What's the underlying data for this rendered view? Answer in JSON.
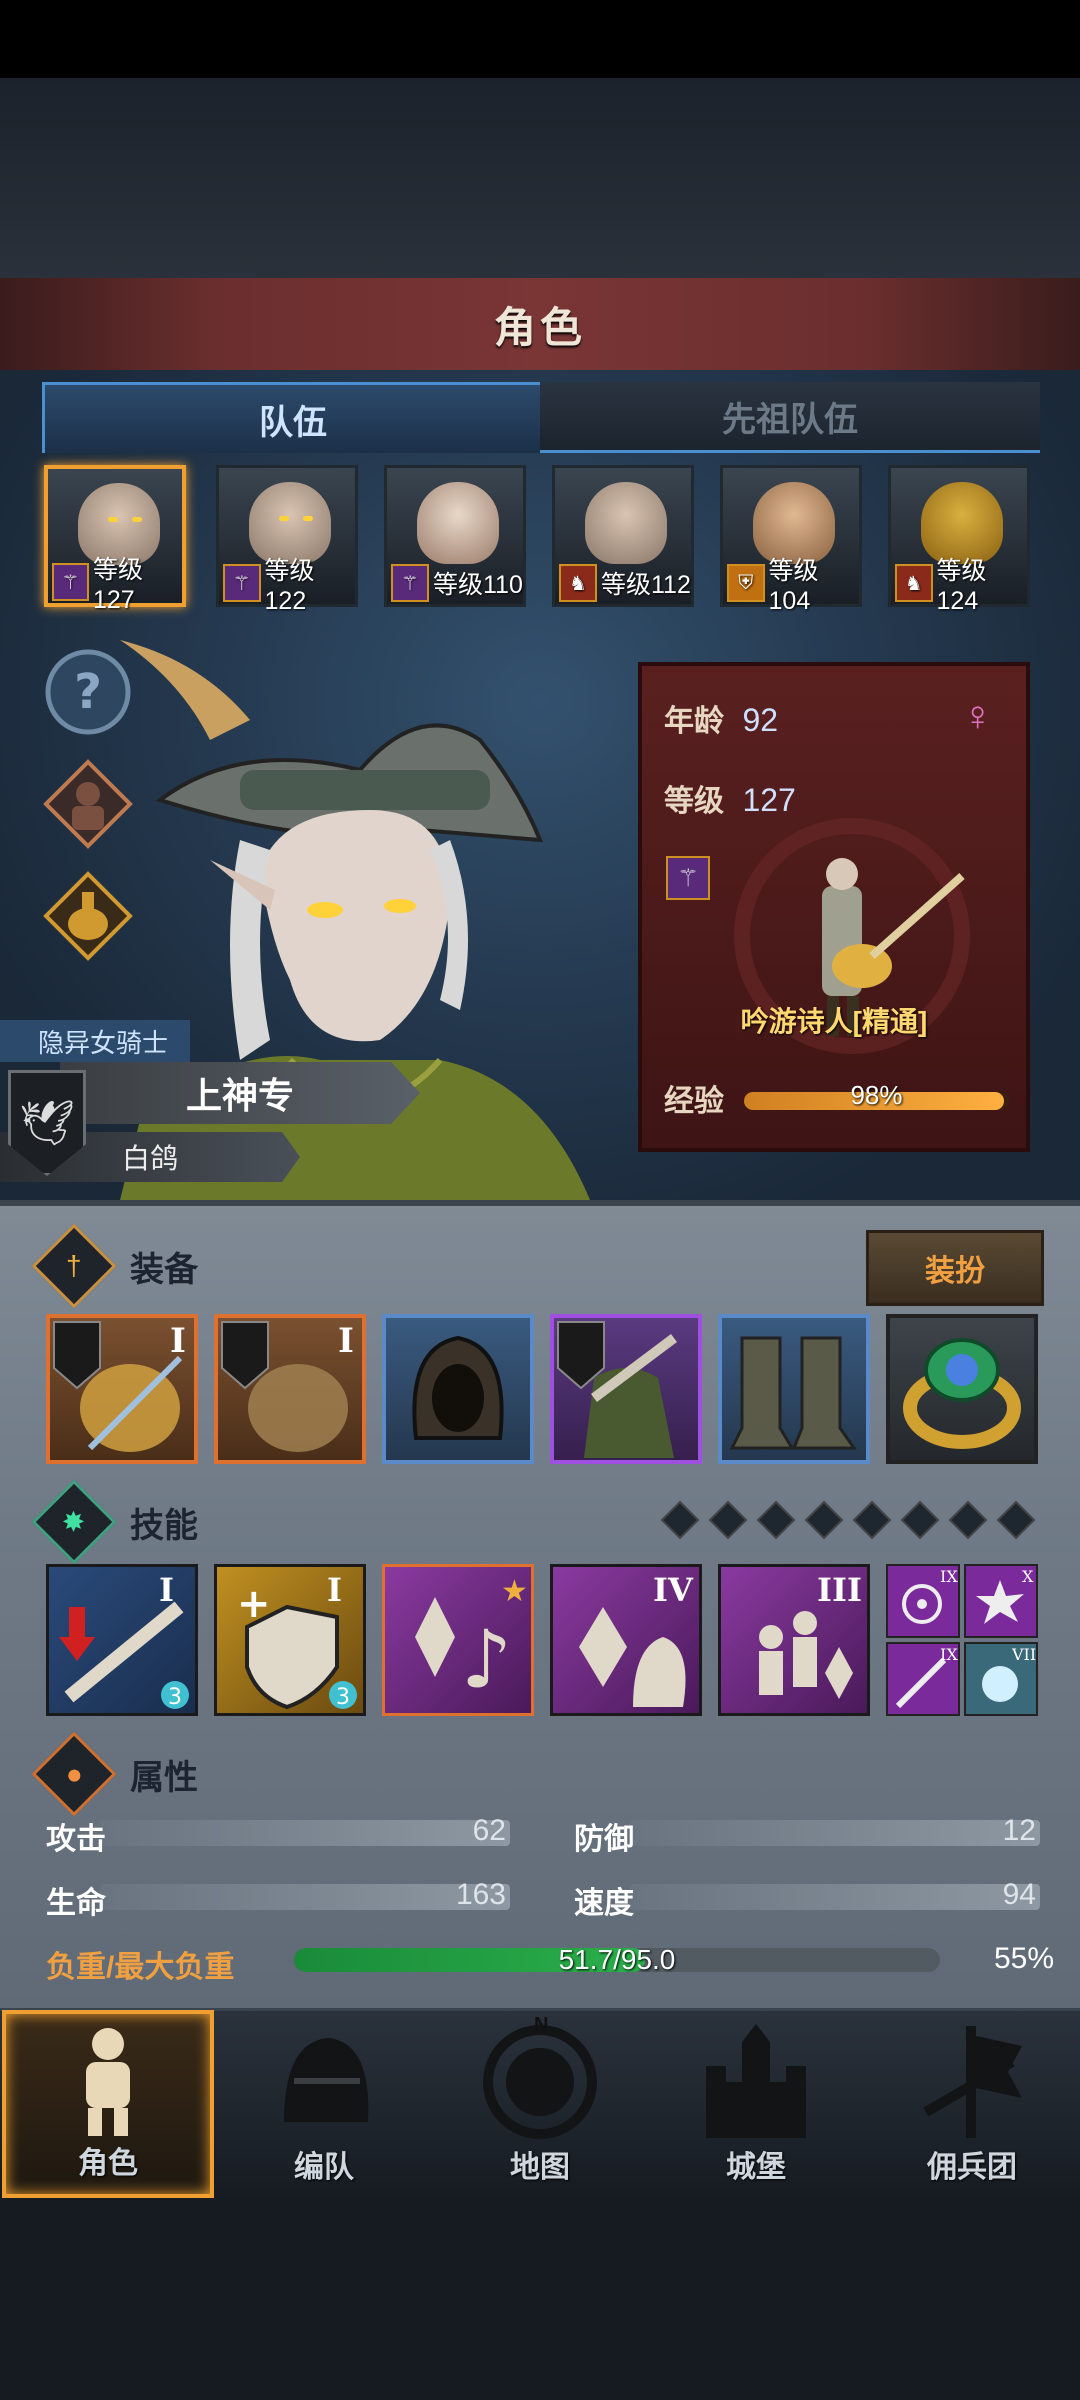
{
  "header": {
    "title": "角色"
  },
  "tabs": [
    {
      "label": "队伍",
      "active": true
    },
    {
      "label": "先祖队伍",
      "active": false
    }
  ],
  "team": [
    {
      "level_text": "等级127",
      "class_icon": "staff-icon",
      "selected": true
    },
    {
      "level_text": "等级122",
      "class_icon": "staff-icon",
      "selected": false
    },
    {
      "level_text": "等级110",
      "class_icon": "staff-icon",
      "selected": false
    },
    {
      "level_text": "等级112",
      "class_icon": "horse-icon",
      "selected": false
    },
    {
      "level_text": "等级104",
      "class_icon": "shield-icon",
      "selected": false
    },
    {
      "level_text": "等级124",
      "class_icon": "horse-icon",
      "selected": false
    }
  ],
  "side_icons": [
    "help-icon",
    "character-icon",
    "potion-icon"
  ],
  "hero": {
    "subtitle": "隐异女骑士",
    "name": "上神专",
    "faction": "白鸽",
    "age_label": "年龄",
    "age": "92",
    "level_label": "等级",
    "level": "127",
    "class_name": "吟游诗人[精通]",
    "exp_label": "经验",
    "exp_text": "98%",
    "exp_fraction": 0.98
  },
  "equipment": {
    "title": "装备",
    "dress_button": "装扮",
    "slots": [
      {
        "icon": "lute-icon",
        "rank": "I",
        "frame": "orange"
      },
      {
        "icon": "lute-icon",
        "rank": "I",
        "frame": "orange"
      },
      {
        "icon": "hood-icon",
        "rank": "",
        "frame": "blue"
      },
      {
        "icon": "cloak-icon",
        "rank": "",
        "frame": "purple"
      },
      {
        "icon": "boots-icon",
        "rank": "",
        "frame": "blue"
      },
      {
        "icon": "ring-icon",
        "rank": "",
        "frame": "none"
      }
    ]
  },
  "skills": {
    "title": "技能",
    "slots": [
      {
        "icon": "sword-debuff-icon",
        "rank": "I",
        "badge": "3"
      },
      {
        "icon": "heal-shield-icon",
        "rank": "I",
        "badge": "3"
      },
      {
        "icon": "music-crystal-icon",
        "rank": "",
        "badge": ""
      },
      {
        "icon": "crystal-song-icon",
        "rank": "IV",
        "badge": ""
      },
      {
        "icon": "team-crystal-icon",
        "rank": "III",
        "badge": ""
      }
    ],
    "mini_slots": [
      {
        "icon": "target-icon",
        "rank": "IX"
      },
      {
        "icon": "burst-icon",
        "rank": "X"
      },
      {
        "icon": "wand-icon",
        "rank": "IX"
      },
      {
        "icon": "frost-icon",
        "rank": "VII"
      }
    ]
  },
  "attributes": {
    "title": "属性",
    "attack_label": "攻击",
    "attack": "62",
    "defense_label": "防御",
    "defense": "12",
    "hp_label": "生命",
    "hp": "163",
    "speed_label": "速度",
    "speed": "94",
    "load_label": "负重/最大负重",
    "load_text": "51.7/95.0",
    "load_percent": "55%",
    "load_fraction": 0.544
  },
  "nav": [
    {
      "label": "角色",
      "icon": "knight-icon",
      "active": true
    },
    {
      "label": "编队",
      "icon": "helmet-icon",
      "active": false
    },
    {
      "label": "地图",
      "icon": "compass-icon",
      "active": false
    },
    {
      "label": "城堡",
      "icon": "castle-icon",
      "active": false
    },
    {
      "label": "佣兵团",
      "icon": "banner-icon",
      "active": false
    }
  ],
  "compass_letter": "N"
}
